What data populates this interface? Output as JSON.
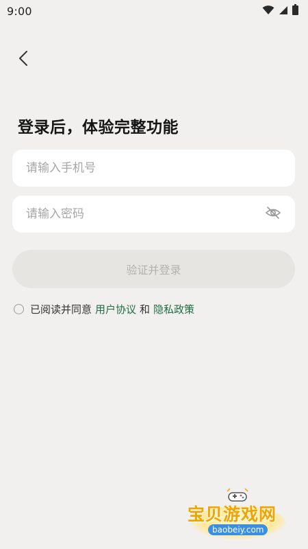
{
  "status_bar": {
    "time": "9:00",
    "icons": [
      "wifi-icon",
      "cellular-signal-icon",
      "battery-icon"
    ]
  },
  "nav": {
    "back_icon": "chevron-left-icon"
  },
  "page": {
    "title": "登录后，体验完整功能"
  },
  "form": {
    "phone_placeholder": "请输入手机号",
    "phone_value": "",
    "password_placeholder": "请输入密码",
    "password_value": "",
    "password_toggle_icon": "eye-off-icon",
    "submit_label": "验证并登录"
  },
  "agreement": {
    "checked": false,
    "prefix": "已阅读并同意",
    "user_agreement": "用户协议",
    "conjunction": "和",
    "privacy_policy": "隐私政策"
  },
  "watermark": {
    "name": "宝贝游戏网",
    "url": "baobeiy.com"
  },
  "colors": {
    "background": "#f1f0ee",
    "link": "#1f6b45",
    "button_disabled_bg": "#e6e5e1",
    "button_disabled_text": "#b3b2ae"
  }
}
